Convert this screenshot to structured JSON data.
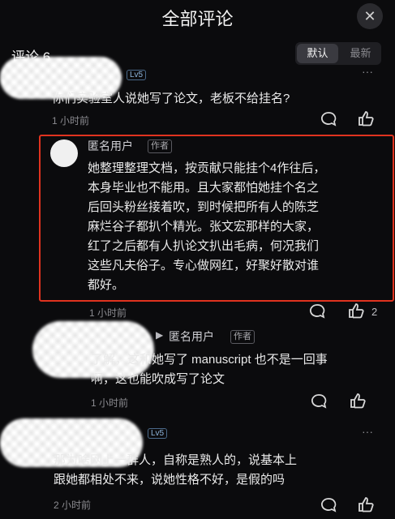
{
  "header": {
    "title": "全部评论",
    "close_symbol": "✕"
  },
  "comments_bar": {
    "count_label": "评论 6",
    "sort_default": "默认",
    "sort_latest": "最新"
  },
  "comment1": {
    "level": "Lv5",
    "text": "你们实验室人说她写了论文，老板不给挂名?",
    "time": "1 小时前"
  },
  "reply1": {
    "user": "匿名用户",
    "tag": "作者",
    "lines": [
      "她整理整理文档，按贡献只能挂个4作往后，",
      "本身毕业也不能用。且大家都怕她挂个名之",
      "后回头粉丝接着吹，到时候把所有人的陈芝",
      "麻烂谷子都扒个精光。张文宏那样的大家，",
      "红了之后都有人扒论文扒出毛病，何况我们",
      "这些凡夫俗子。专心做网红，好聚好散对谁",
      "都好。"
    ],
    "time": "1 小时前",
    "likes": "2"
  },
  "reply2": {
    "user": "匿名用户",
    "tag": "作者",
    "lines": [
      "了解，这和她写了 manuscript 也不是一回事",
      "啊，这也能吹成写了论文"
    ],
    "time": "1 小时前"
  },
  "comment2": {
    "level": "Lv5",
    "lines": [
      "那为啥网上一群人，自称是熟人的，说基本上",
      "跟她都相处不来，说她性格不好，是假的吗"
    ],
    "time": "2 小时前"
  },
  "icons": {
    "comment": "comment-bubble-icon",
    "like": "thumbs-up-icon",
    "more": "more-dots-icon"
  }
}
